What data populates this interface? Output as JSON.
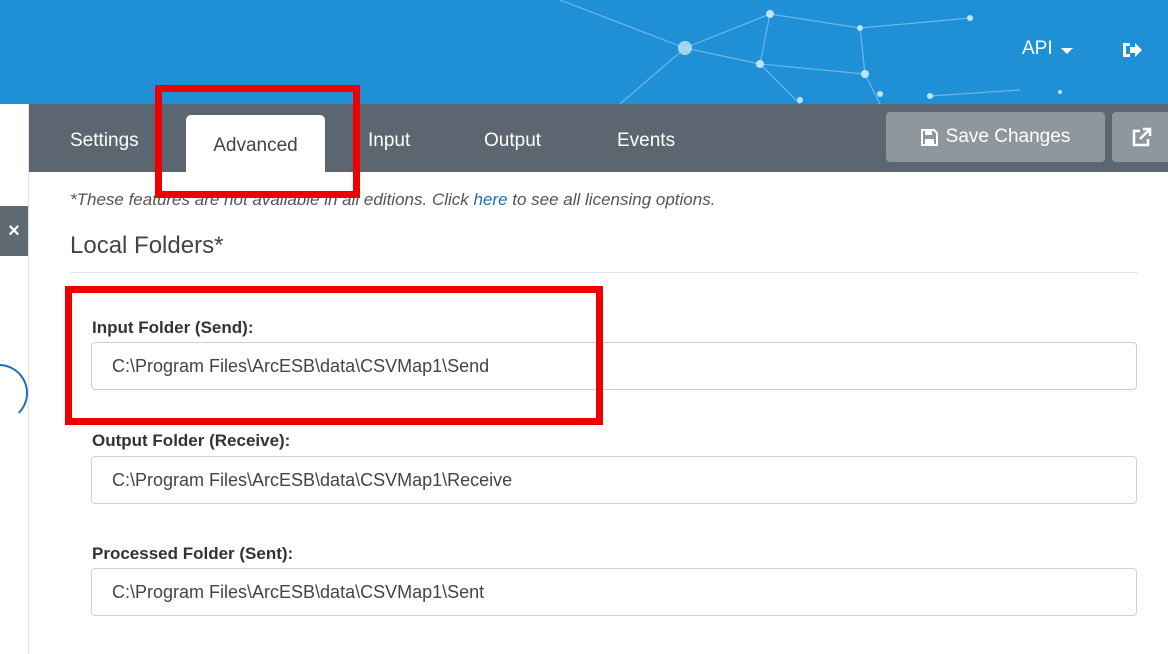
{
  "header": {
    "api_label": "API"
  },
  "sidebar": {
    "close_label": "×"
  },
  "tabs": [
    {
      "label": "Settings"
    },
    {
      "label": "Advanced"
    },
    {
      "label": "Input"
    },
    {
      "label": "Output"
    },
    {
      "label": "Events"
    }
  ],
  "active_tab": "Advanced",
  "toolbar": {
    "save_label": "Save Changes"
  },
  "notice": {
    "prefix": "*These features are not available in all editions. Click ",
    "link": "here",
    "suffix": " to see all licensing options."
  },
  "section": {
    "title": "Local Folders*"
  },
  "fields": [
    {
      "label": "Input Folder (Send):",
      "value": "C:\\Program Files\\ArcESB\\data\\CSVMap1\\Send"
    },
    {
      "label": "Output Folder (Receive):",
      "value": "C:\\Program Files\\ArcESB\\data\\CSVMap1\\Receive"
    },
    {
      "label": "Processed Folder (Sent):",
      "value": "C:\\Program Files\\ArcESB\\data\\CSVMap1\\Sent"
    }
  ],
  "colors": {
    "header_blue": "#1f8fd6",
    "tabbar_gray": "#5b6670",
    "highlight_red": "#ee0000",
    "link_blue": "#1f6fb2"
  },
  "icons": {
    "save": "floppy-disk-icon",
    "popout": "external-link-icon",
    "logout": "sign-out-icon",
    "api_menu": "caret-down-icon"
  }
}
